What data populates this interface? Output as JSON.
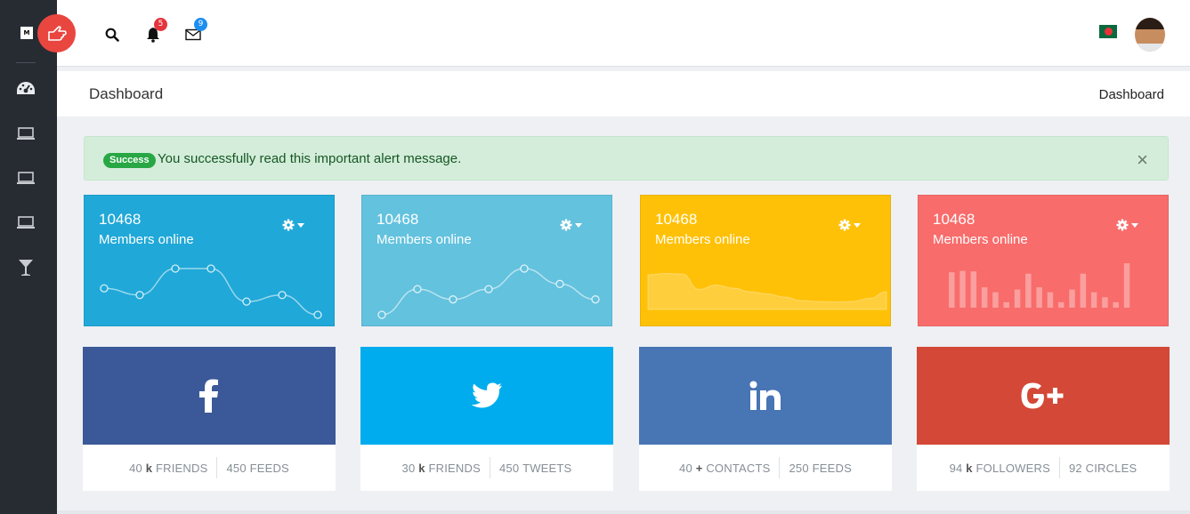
{
  "sidebar": {
    "logo": "M",
    "items": [
      {
        "icon": "dashboard-icon"
      },
      {
        "icon": "laptop-icon"
      },
      {
        "icon": "laptop-icon"
      },
      {
        "icon": "laptop-icon"
      },
      {
        "icon": "cocktail-icon"
      }
    ]
  },
  "topbar": {
    "toggle_icon": "hand-pointer-icon",
    "notifications_count": "5",
    "messages_count": "9",
    "notification_badge_color": "#e5343d",
    "message_badge_color": "#1c8ef0"
  },
  "breadcrumb": {
    "title": "Dashboard",
    "current": "Dashboard"
  },
  "alert": {
    "badge": "Success",
    "message": "You successfully read this important alert message.",
    "close": "×"
  },
  "stats": [
    {
      "number": "10468",
      "label": "Members online",
      "color": "#20a8d8",
      "chart": "line",
      "values": [
        5,
        4,
        8,
        8,
        3,
        4,
        1
      ]
    },
    {
      "number": "10468",
      "label": "Members online",
      "color": "#63c2de",
      "chart": "line",
      "values": [
        1,
        6,
        4,
        6,
        10,
        7,
        4
      ]
    },
    {
      "number": "10468",
      "label": "Members online",
      "color": "#ffc107",
      "chart": "area",
      "values": [
        78,
        81,
        80,
        45,
        55,
        48,
        40,
        35,
        28,
        20,
        18,
        17,
        18,
        25,
        40
      ]
    },
    {
      "number": "10468",
      "label": "Members online",
      "color": "#f86c6b",
      "chart": "bar",
      "values": [
        78,
        81,
        80,
        45,
        34,
        12,
        40,
        75,
        45,
        34,
        12,
        40,
        75,
        34,
        23,
        12,
        98
      ]
    }
  ],
  "social": [
    {
      "icon": "facebook-icon",
      "color": "#3b5998",
      "count1": "40",
      "unit1": "k",
      "label1": "FRIENDS",
      "count2": "450",
      "label2": "FEEDS"
    },
    {
      "icon": "twitter-icon",
      "color": "#00aced",
      "count1": "30",
      "unit1": "k",
      "label1": "FRIENDS",
      "count2": "450",
      "label2": "TWEETS"
    },
    {
      "icon": "linkedin-icon",
      "color": "#4875b4",
      "count1": "40",
      "unit1": "+",
      "label1": "CONTACTS",
      "count2": "250",
      "label2": "FEEDS"
    },
    {
      "icon": "google-plus-icon",
      "color": "#d34836",
      "count1": "94",
      "unit1": "k",
      "label1": "FOLLOWERS",
      "count2": "92",
      "label2": "CIRCLES"
    }
  ]
}
